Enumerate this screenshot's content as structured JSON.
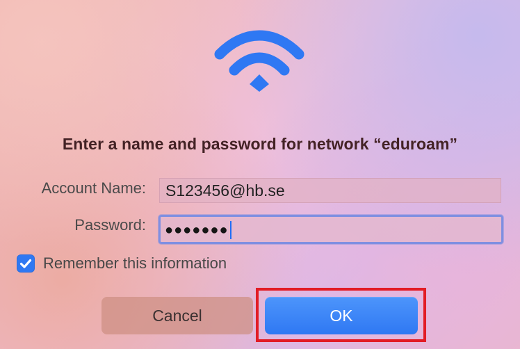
{
  "dialog": {
    "icon": "wifi-icon",
    "title": "Enter a name and password for network “eduroam”",
    "account_label": "Account Name:",
    "account_value": "S123456@hb.se",
    "password_label": "Password:",
    "password_masked": "●●●●●●●",
    "remember_label": "Remember this information",
    "remember_checked": true,
    "cancel_label": "Cancel",
    "ok_label": "OK"
  },
  "colors": {
    "accent": "#2f78f3",
    "highlight": "#e21c25",
    "title": "#432225"
  }
}
